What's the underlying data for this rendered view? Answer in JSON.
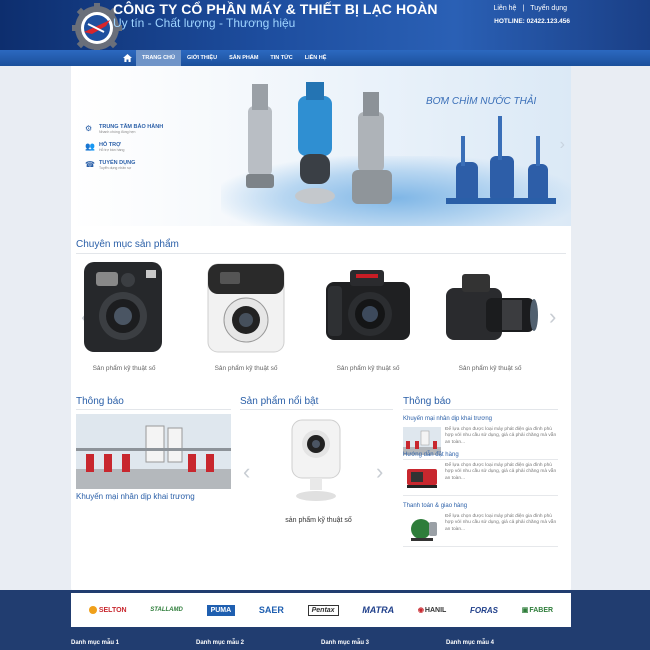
{
  "header": {
    "company_name": "CÔNG TY CỔ PHẦN MÁY & THIẾT BỊ LẠC HOÀN",
    "slogan": "Uy tín - Chất lượng - Thương hiệu",
    "top_links": [
      "Liên hệ",
      "Tuyển dụng"
    ],
    "link_separator": "|",
    "hotline": "HOTLINE: 02422.123.456"
  },
  "nav": {
    "home_icon": "home-icon",
    "items": [
      "Trang chủ",
      "Giới thiệu",
      "Sản phẩm",
      "Tin tức",
      "Liên hệ"
    ],
    "active_index": 0
  },
  "banner": {
    "title": "BƠM CHÌM NƯỚC THẢI",
    "links": [
      {
        "title": "Trung tâm bảo hành",
        "subtitle": "Nhanh chóng đúng hẹn",
        "icon": "gears-icon"
      },
      {
        "title": "Hỗ trợ",
        "subtitle": "Hỗ trợ bán hàng",
        "icon": "users-icon"
      },
      {
        "title": "Tuyển dụng",
        "subtitle": "Tuyển dụng nhân sự",
        "icon": "recruit-icon"
      }
    ]
  },
  "product_categories": {
    "heading": "Chuyên mục sản phẩm",
    "items": [
      {
        "caption": "Sản phẩm kỹ thuật số"
      },
      {
        "caption": "Sản phẩm kỹ thuật số"
      },
      {
        "caption": "Sản phẩm kỹ thuật số"
      },
      {
        "caption": "Sản phẩm kỹ thuật số"
      }
    ]
  },
  "news": {
    "heading": "Thông báo",
    "caption": "Khuyến mại nhân dịp khai trương"
  },
  "featured": {
    "heading": "Sản phẩm nổi bật",
    "caption": "sản phẩm kỹ thuật số"
  },
  "announcements": {
    "heading": "Thông báo",
    "items": [
      {
        "title": "Khuyến mại nhân dịp khai trương",
        "desc": "Để lựa chọn được loại máy phát điện gia đình phù hợp với nhu cầu sử dụng, giá cả phải chăng mà vẫn an toàn..."
      },
      {
        "title": "Hướng dẫn đặt hàng",
        "desc": "Để lựa chọn được loại máy phát điện gia đình phù hợp với nhu cầu sử dụng, giá cả phải chăng mà vẫn an toàn..."
      },
      {
        "title": "Thanh toán & giao hàng",
        "desc": "Để lựa chọn được loại máy phát điện gia đình phù hợp với nhu cầu sử dụng, giá cả phải chăng mà vẫn an toàn..."
      }
    ]
  },
  "brands": [
    "SELTON",
    "STALLAMD",
    "PUMA",
    "SAER",
    "Pentax",
    "MATRA",
    "HANIL",
    "FORAS",
    "FABER"
  ],
  "footer": {
    "categories": [
      "Danh mục mẫu 1",
      "Danh mục mẫu 2",
      "Danh mục mẫu 3",
      "Danh mục mẫu 4"
    ]
  },
  "colors": {
    "header_dark": "#0d2e6e",
    "nav_blue": "#1b4f9b",
    "accent_text": "#2a5fa8",
    "footer_bg": "#213d70"
  }
}
